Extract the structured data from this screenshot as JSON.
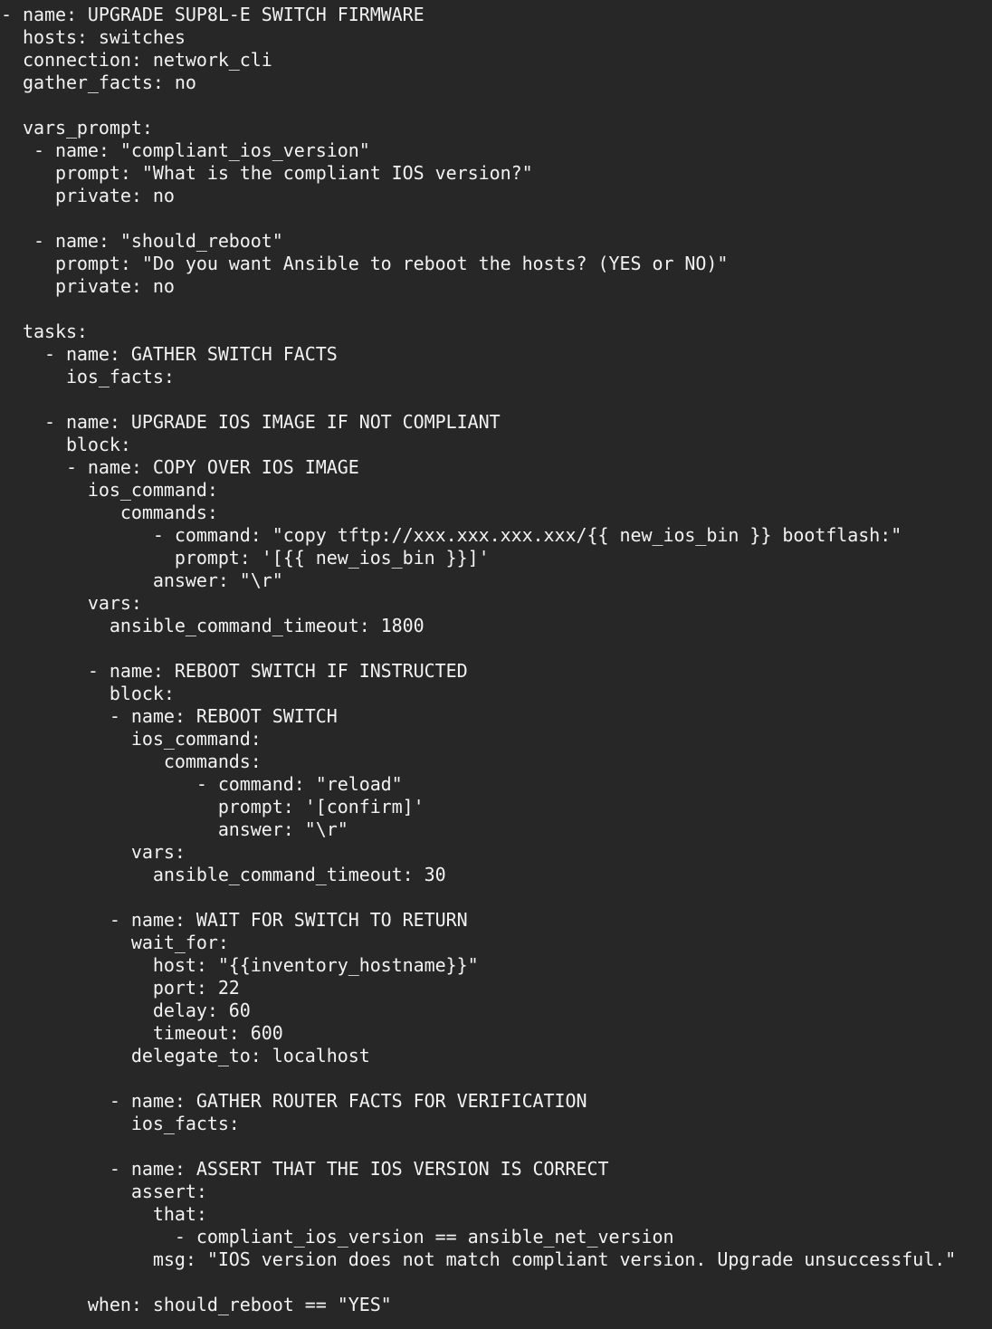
{
  "document": {
    "language": "yaml",
    "lines": [
      "- name: UPGRADE SUP8L-E SWITCH FIRMWARE",
      "  hosts: switches",
      "  connection: network_cli",
      "  gather_facts: no",
      "",
      "  vars_prompt:",
      "   - name: \"compliant_ios_version\"",
      "     prompt: \"What is the compliant IOS version?\"",
      "     private: no",
      "",
      "   - name: \"should_reboot\"",
      "     prompt: \"Do you want Ansible to reboot the hosts? (YES or NO)\"",
      "     private: no",
      "",
      "  tasks:",
      "    - name: GATHER SWITCH FACTS",
      "      ios_facts:",
      "",
      "    - name: UPGRADE IOS IMAGE IF NOT COMPLIANT",
      "      block:",
      "      - name: COPY OVER IOS IMAGE",
      "        ios_command:",
      "           commands:",
      "              - command: \"copy tftp://xxx.xxx.xxx.xxx/{{ new_ios_bin }} bootflash:\"",
      "                prompt: '[{{ new_ios_bin }}]'",
      "              answer: \"\\r\"",
      "        vars:",
      "          ansible_command_timeout: 1800",
      "",
      "        - name: REBOOT SWITCH IF INSTRUCTED",
      "          block:",
      "          - name: REBOOT SWITCH",
      "            ios_command:",
      "               commands:",
      "                  - command: \"reload\"",
      "                    prompt: '[confirm]'",
      "                    answer: \"\\r\"",
      "            vars:",
      "              ansible_command_timeout: 30",
      "",
      "          - name: WAIT FOR SWITCH TO RETURN",
      "            wait_for:",
      "              host: \"{{inventory_hostname}}\"",
      "              port: 22",
      "              delay: 60",
      "              timeout: 600",
      "            delegate_to: localhost",
      "",
      "          - name: GATHER ROUTER FACTS FOR VERIFICATION",
      "            ios_facts:",
      "",
      "          - name: ASSERT THAT THE IOS VERSION IS CORRECT",
      "            assert:",
      "              that:",
      "                - compliant_ios_version == ansible_net_version",
      "              msg: \"IOS version does not match compliant version. Upgrade unsuccessful.\"",
      "",
      "        when: should_reboot == \"YES\""
    ]
  },
  "colors": {
    "background": "#272727",
    "text": "#f2f2f2"
  }
}
